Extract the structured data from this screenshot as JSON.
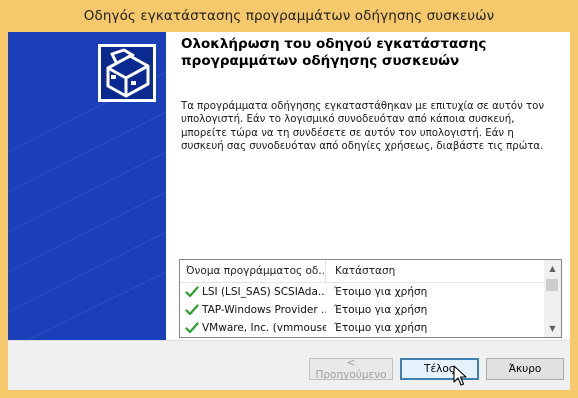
{
  "window": {
    "title": "Οδηγός εγκατάστασης προγραμμάτων οδήγησης συσκευών"
  },
  "page": {
    "heading": "Ολοκλήρωση του οδηγού εγκατάστασης προγραμμάτων οδήγησης συσκευών",
    "description": "Τα προγράμματα οδήγησης εγκαταστάθηκαν με επιτυχία σε αυτόν τον υπολογιστή. Εάν το λογισμικό συνοδευόταν από κάποια συσκευή, μπορείτε τώρα να τη συνδέσετε σε αυτόν τον υπολογιστή. Εάν η συσκευή σας συνοδευόταν από οδηγίες χρήσεως, διαβάστε τις πρώτα."
  },
  "driver_list": {
    "columns": [
      "Όνομα προγράμματος οδ...",
      "Κατάσταση"
    ],
    "rows": [
      {
        "name": "LSI (LSI_SAS) SCSIAda...",
        "status": "Έτοιμο για χρήση",
        "icon": "green-check-icon"
      },
      {
        "name": "TAP-Windows Provider ...",
        "status": "Έτοιμο για χρήση",
        "icon": "green-check-icon"
      },
      {
        "name": "VMware, Inc. (vmmouse)...",
        "status": "Έτοιμο για χρήση",
        "icon": "green-check-icon"
      }
    ]
  },
  "buttons": {
    "back": "< Προηγούμενο",
    "finish": "Τέλος",
    "cancel": "Άκυρο"
  },
  "colors": {
    "title_bar": "#f4c86b",
    "side_panel": "#1a3fb8",
    "check": "#2e9e2e"
  }
}
